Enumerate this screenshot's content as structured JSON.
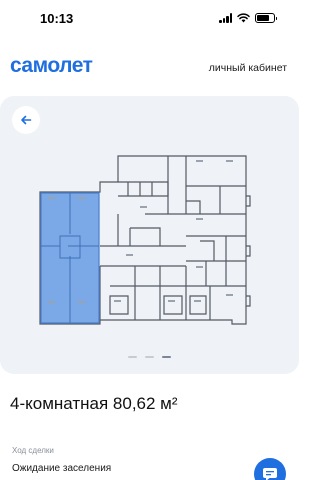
{
  "status_bar": {
    "time": "10:13",
    "battery_level": 0.78
  },
  "header": {
    "logo": "самолет",
    "cabinet_link": "личный кабинет"
  },
  "plan": {
    "highlight_color": "#7ba8e6",
    "wall_color": "#555a63",
    "carousel": {
      "total": 3,
      "active_index": 2
    }
  },
  "apartment": {
    "title": "4-комнатная 80,62 м²"
  },
  "deal": {
    "label": "Ход сделки",
    "status": "Ожидание заселения"
  },
  "icons": {
    "back": "arrow-left-icon",
    "chat": "chat-icon"
  },
  "colors": {
    "brand": "#1f6fe0",
    "card_bg": "#eff2f6"
  }
}
